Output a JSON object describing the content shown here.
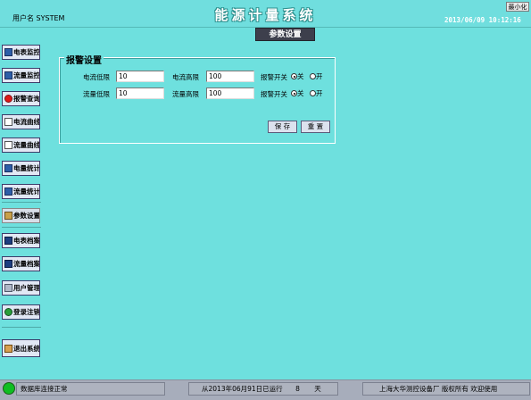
{
  "header": {
    "title": "能源计量系统",
    "user_label": "用户名 SYSTEM",
    "datetime": "2013/06/09 10:12:16",
    "minimize_label": "最小化"
  },
  "page_title": "参数设置",
  "sidebar": {
    "items": [
      {
        "label": "电表监控",
        "icon": "meter-monitor-icon"
      },
      {
        "label": "流量监控",
        "icon": "flow-monitor-icon"
      },
      {
        "label": "报警查询",
        "icon": "alarm-icon"
      },
      {
        "label": "电流曲线",
        "icon": "current-curve-icon"
      },
      {
        "label": "流量曲线",
        "icon": "flow-curve-icon"
      },
      {
        "label": "电量统计",
        "icon": "power-stats-icon"
      },
      {
        "label": "流量统计",
        "icon": "flow-stats-icon"
      },
      {
        "label": "参数设置",
        "icon": "settings-icon"
      },
      {
        "label": "电表档案",
        "icon": "meter-archive-icon"
      },
      {
        "label": "流量档案",
        "icon": "flow-archive-icon"
      },
      {
        "label": "用户管理",
        "icon": "user-manage-icon"
      },
      {
        "label": "登录注销",
        "icon": "logout-icon"
      },
      {
        "label": "退出系统",
        "icon": "exit-icon"
      }
    ]
  },
  "alarm_settings": {
    "title": "报警设置",
    "current_low_label": "电流低限",
    "current_low_value": "10",
    "current_high_label": "电流高限",
    "current_high_value": "100",
    "flow_low_label": "流量低限",
    "flow_low_value": "10",
    "flow_high_label": "流量高限",
    "flow_high_value": "100",
    "switch_label_1": "报警开关",
    "switch_label_2": "报警开关",
    "off_label": "关",
    "on_label": "开",
    "save_label": "保 存",
    "reset_label": "重 置"
  },
  "status": {
    "db_status": "数据库连接正常",
    "running_text": "从2013年06月91日已运行",
    "days_value": "8",
    "days_unit": "天",
    "copyright": "上海大华测控设备厂 版权所有 欢迎使用"
  },
  "colors": {
    "background": "#6ee0de",
    "status_led": "#0fbe22",
    "page_title_bg": "#3d3f4c"
  }
}
